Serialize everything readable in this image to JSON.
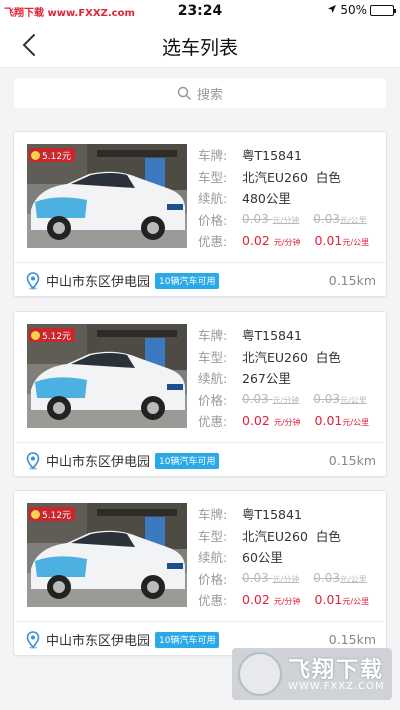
{
  "status_bar": {
    "left_text": "飞翔下载 www.FXXZ.com",
    "time": "23:24",
    "battery": "50%",
    "battery_level": 0.5
  },
  "nav": {
    "title": "选车列表",
    "back_icon": "chevron-left-icon"
  },
  "search": {
    "placeholder": "搜索",
    "icon": "search-icon"
  },
  "labels": {
    "plate": "车牌:",
    "model": "车型:",
    "range": "续航:",
    "price": "价格:",
    "discount": "优惠:"
  },
  "cars": [
    {
      "fuel_badge": "5.12元",
      "plate": "粤T15841",
      "model": "北汽EU260",
      "color": "白色",
      "range": "480公里",
      "old_price_min": "0.03",
      "old_price_min_unit": "元/分钟",
      "old_price_km": "0.03",
      "old_price_km_unit": "元/公里",
      "new_price_min": "0.02",
      "new_price_min_unit": "元/分钟",
      "new_price_km": "0.01",
      "new_price_km_unit": "元/公里",
      "location": "中山市东区伊电园",
      "available": "10辆汽车可用",
      "distance": "0.15km"
    },
    {
      "fuel_badge": "5.12元",
      "plate": "粤T15841",
      "model": "北汽EU260",
      "color": "白色",
      "range": "267公里",
      "old_price_min": "0.03",
      "old_price_min_unit": "元/分钟",
      "old_price_km": "0.03",
      "old_price_km_unit": "元/公里",
      "new_price_min": "0.02",
      "new_price_min_unit": "元/分钟",
      "new_price_km": "0.01",
      "new_price_km_unit": "元/公里",
      "location": "中山市东区伊电园",
      "available": "10辆汽车可用",
      "distance": "0.15km"
    },
    {
      "fuel_badge": "5.12元",
      "plate": "粤T15841",
      "model": "北汽EU260",
      "color": "白色",
      "range": "60公里",
      "old_price_min": "0.03",
      "old_price_min_unit": "元/分钟",
      "old_price_km": "0.03",
      "old_price_km_unit": "元/公里",
      "new_price_min": "0.02",
      "new_price_min_unit": "元/分钟",
      "new_price_km": "0.01",
      "new_price_km_unit": "元/公里",
      "location": "中山市东区伊电园",
      "available": "10辆汽车可用",
      "distance": "0.15km"
    }
  ],
  "watermark": {
    "title": "飞翔下载",
    "url": "WWW.FXXZ.COM"
  },
  "colors": {
    "accent_red": "#e0213a",
    "tag_blue": "#29a9e8",
    "background": "#f4f4f6"
  }
}
